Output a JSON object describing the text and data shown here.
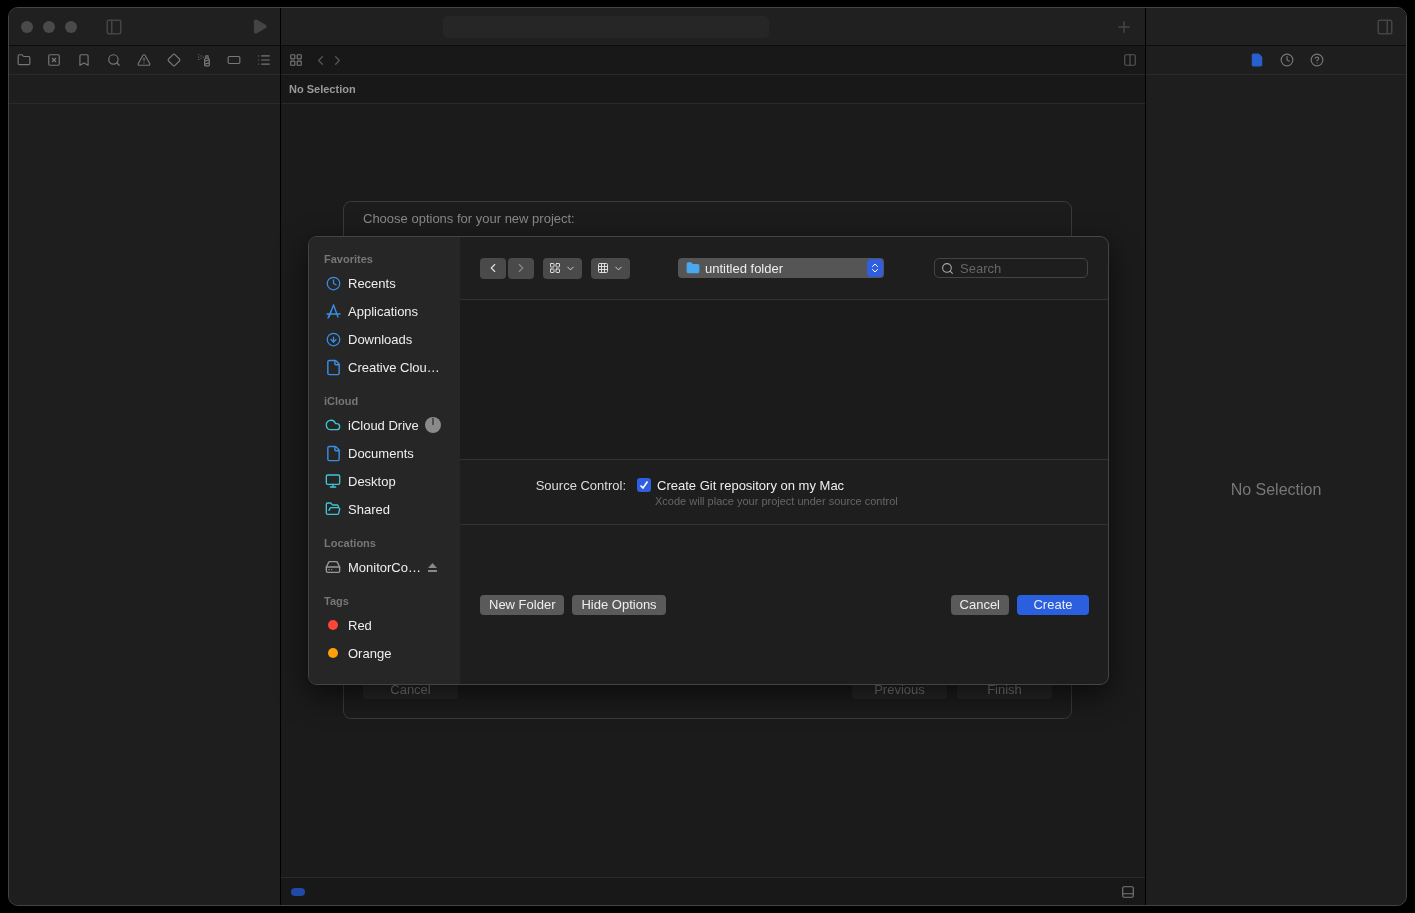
{
  "inspector": {
    "tabs": [
      {
        "kind": "file",
        "selected": true
      },
      {
        "kind": "history",
        "selected": false
      },
      {
        "kind": "help",
        "selected": false
      }
    ],
    "empty_label": "No Selection"
  },
  "editor": {
    "jump_bar_label": "No Selection"
  },
  "back_sheet": {
    "title": "Choose options for your new project:",
    "left_buttons": [
      {
        "label": "Cancel"
      }
    ],
    "right_buttons": [
      {
        "label": "Previous"
      },
      {
        "label": "Finish"
      }
    ]
  },
  "save_panel": {
    "sidebar": [
      {
        "title": "Favorites",
        "items": [
          {
            "label": "Recents",
            "kind": "clock"
          },
          {
            "label": "Applications",
            "kind": "apps"
          },
          {
            "label": "Downloads",
            "kind": "download"
          },
          {
            "label": "Creative Clou…",
            "kind": "document"
          }
        ]
      },
      {
        "title": "iCloud",
        "items": [
          {
            "label": "iCloud Drive",
            "kind": "cloud"
          },
          {
            "label": "Documents",
            "kind": "document"
          },
          {
            "label": "Desktop",
            "kind": "desktop"
          },
          {
            "label": "Shared",
            "kind": "shared"
          }
        ]
      },
      {
        "title": "Locations",
        "items": [
          {
            "label": "MonitorCo…",
            "kind": "drive"
          }
        ]
      },
      {
        "title": "Tags",
        "items": [
          {
            "label": "Red",
            "kind": "tag",
            "color": "#ff453a"
          },
          {
            "label": "Orange",
            "kind": "tag",
            "color": "#ff9f0a"
          }
        ]
      }
    ],
    "location": {
      "value": "untitled folder"
    },
    "search": {
      "placeholder": "Search"
    },
    "source_control": {
      "label": "Source Control:",
      "checkbox": {
        "label": "Create Git repository on my Mac",
        "checked": true
      },
      "hint": "Xcode will place your project under source control"
    },
    "left_buttons": [
      {
        "label": "New Folder",
        "default": false
      },
      {
        "label": "Hide Options",
        "default": false
      }
    ],
    "right_buttons": [
      {
        "label": "Cancel",
        "default": false
      },
      {
        "label": "Create",
        "default": true
      }
    ]
  }
}
